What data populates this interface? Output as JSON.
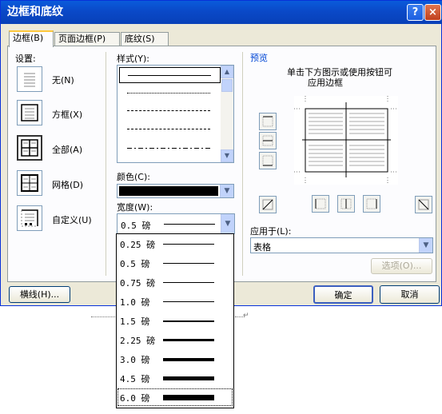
{
  "title": "边框和底纹",
  "title_buttons": {
    "help": "?",
    "close": "×"
  },
  "tabs": [
    {
      "label": "边框(B)",
      "active": true
    },
    {
      "label": "页面边框(P)",
      "active": false
    },
    {
      "label": "底纹(S)",
      "active": false
    }
  ],
  "settings": {
    "label": "设置:",
    "items": [
      {
        "label": "无(N)",
        "icon": "border-none-icon",
        "selected": false
      },
      {
        "label": "方框(X)",
        "icon": "border-box-icon",
        "selected": false
      },
      {
        "label": "全部(A)",
        "icon": "border-all-icon",
        "selected": true
      },
      {
        "label": "网格(D)",
        "icon": "border-grid-icon",
        "selected": false
      },
      {
        "label": "自定义(U)",
        "icon": "border-custom-icon",
        "selected": false
      }
    ]
  },
  "style": {
    "label": "样式(Y):",
    "options": [
      "solid",
      "dotted",
      "dashed",
      "dashed-wide",
      "dash-dot"
    ],
    "selected_index": 0
  },
  "color": {
    "label": "颜色(C):",
    "value": "#000000"
  },
  "width": {
    "label": "宽度(W):",
    "value": "0.5 磅",
    "options": [
      "0.25 磅",
      "0.5 磅",
      "0.75 磅",
      "1.0 磅",
      "1.5 磅",
      "2.25 磅",
      "3.0 磅",
      "4.5 磅",
      "6.0 磅"
    ],
    "highlighted_index": 8
  },
  "preview": {
    "label": "预览",
    "instruction_line1": "单击下方图示或使用按钮可",
    "instruction_line2": "应用边框"
  },
  "apply_to": {
    "label": "应用于(L):",
    "value": "表格"
  },
  "buttons": {
    "options": "选项(O)...",
    "horizontal_line": "横线(H)...",
    "ok": "确定",
    "cancel": "取消"
  },
  "colors": {
    "title_bar": "#0a4fd0",
    "dialog_bg": "#ece9d8",
    "tab_highlight": "#ffc83c"
  }
}
